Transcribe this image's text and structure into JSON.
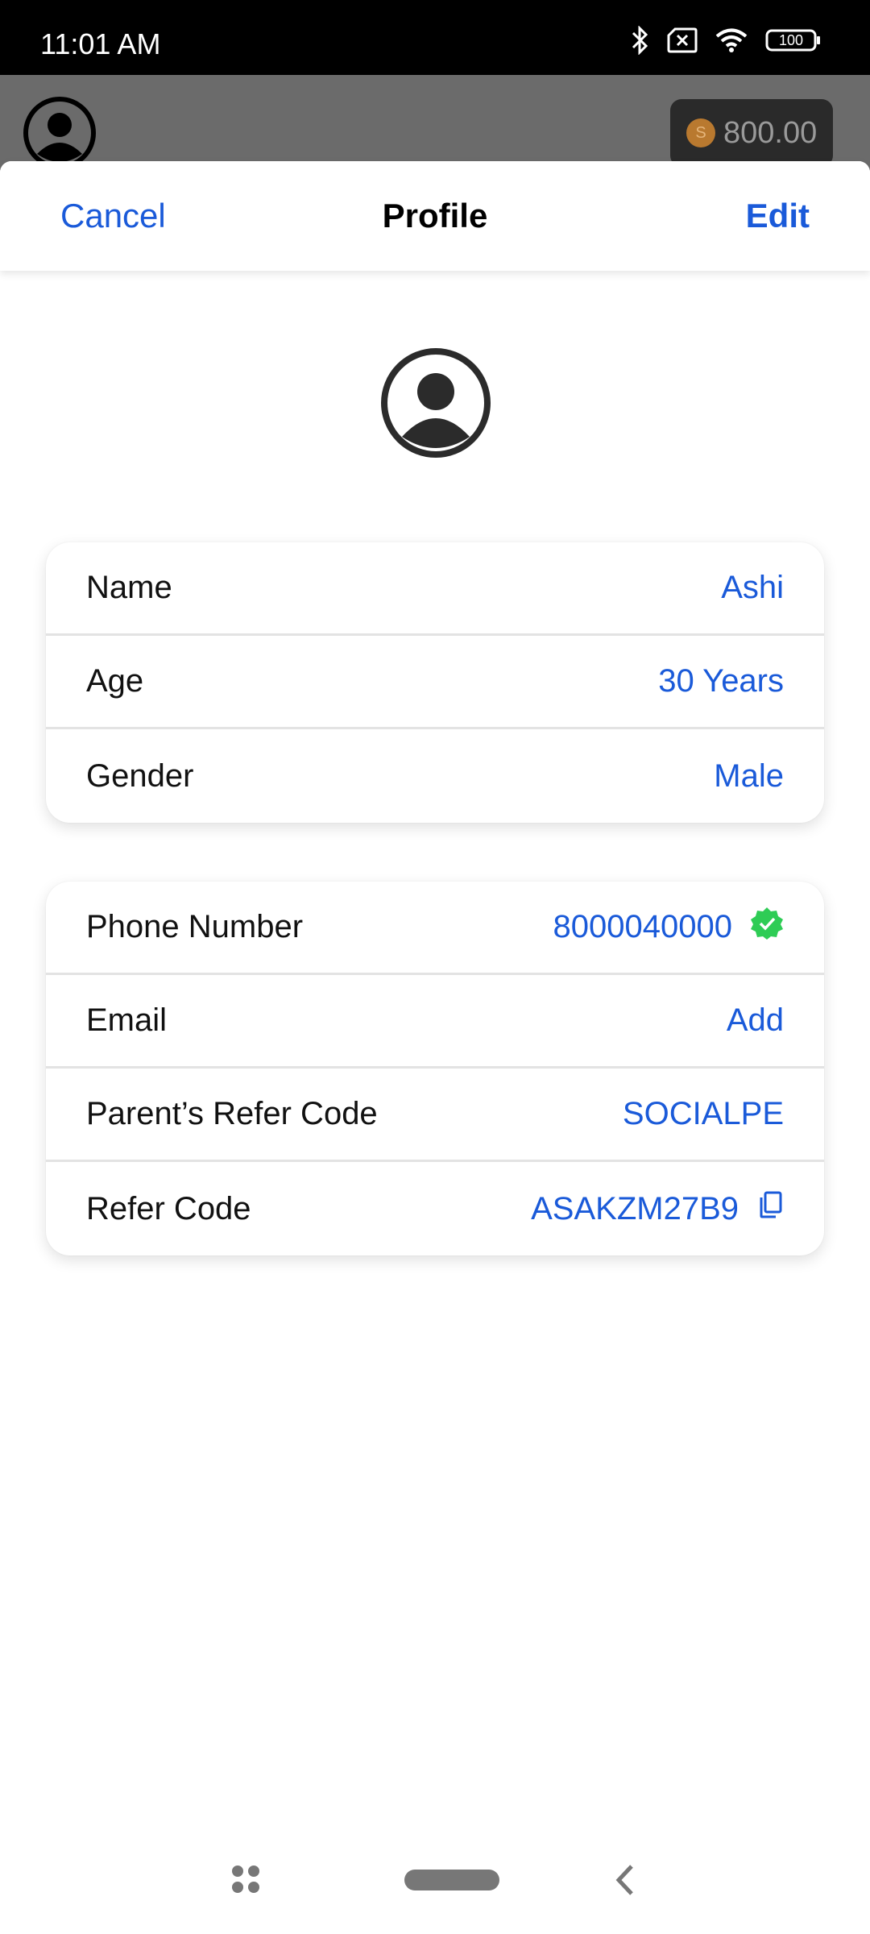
{
  "status_bar": {
    "time": "11:01 AM",
    "battery": "100",
    "icons": [
      "bluetooth-icon",
      "no-sim-icon",
      "wifi-icon",
      "battery-icon"
    ]
  },
  "background": {
    "balance": "800.00",
    "coin_glyph": "S"
  },
  "header": {
    "cancel": "Cancel",
    "title": "Profile",
    "edit": "Edit"
  },
  "personal": [
    {
      "label": "Name",
      "value": "Ashi"
    },
    {
      "label": "Age",
      "value": "30 Years"
    },
    {
      "label": "Gender",
      "value": "Male"
    }
  ],
  "contact": [
    {
      "label": "Phone Number",
      "value": "8000040000"
    },
    {
      "label": "Email",
      "value": "Add"
    },
    {
      "label": "Parent’s Refer Code",
      "value": "SOCIALPE"
    },
    {
      "label": "Refer Code",
      "value": "ASAKZM27B9"
    }
  ],
  "colors": {
    "accent": "#1a5ad9",
    "verified": "#2ecc55"
  }
}
